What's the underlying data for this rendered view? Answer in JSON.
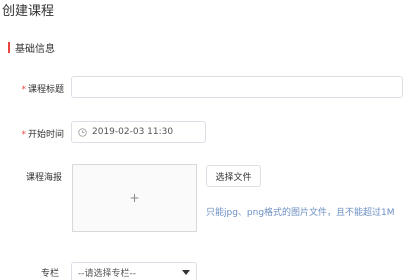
{
  "page": {
    "title": "创建课程"
  },
  "section": {
    "title": "基础信息",
    "accent_color": "#e8453c"
  },
  "form": {
    "course_title": {
      "label": "课程标题",
      "required_mark": "*",
      "value": ""
    },
    "start_time": {
      "label": "开始时间",
      "required_mark": "*",
      "value": "2019-02-03 11:30",
      "icon": "clock-icon"
    },
    "poster": {
      "label": "课程海报",
      "upload_symbol": "+",
      "button_label": "选择文件",
      "hint": "只能jpg、png格式的图片文件，且不能超过1M"
    },
    "column": {
      "label": "专栏",
      "selected": "--请选择专栏--",
      "icon": "caret-down-icon"
    }
  }
}
